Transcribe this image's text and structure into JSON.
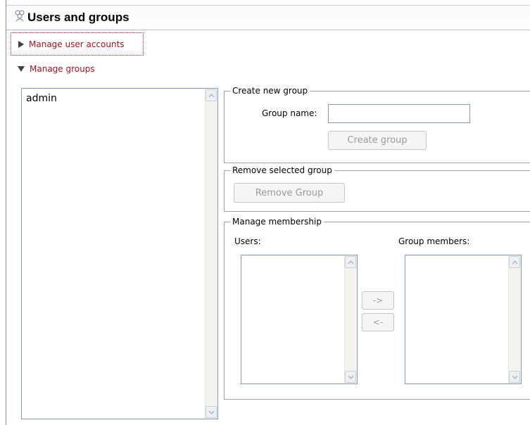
{
  "header": {
    "title": "Users and groups",
    "icon": "users-icon"
  },
  "sections": {
    "manage_user_accounts": {
      "label": "Manage user accounts",
      "expanded": false
    },
    "manage_groups": {
      "label": "Manage groups",
      "expanded": true
    }
  },
  "groups_list": {
    "items": [
      "admin"
    ]
  },
  "create_group": {
    "title": "Create new group",
    "group_name_label": "Group name:",
    "group_name_value": "",
    "create_button": "Create group"
  },
  "remove_group": {
    "title": "Remove selected group",
    "remove_button": "Remove Group"
  },
  "membership": {
    "title": "Manage membership",
    "users_label": "Users:",
    "members_label": "Group members:",
    "add_button": "->",
    "remove_button": "<-",
    "users": [],
    "members": []
  },
  "colors": {
    "section_link": "#a0141e",
    "field_border": "#7f9db9",
    "disabled_text": "#9a9a9a"
  }
}
